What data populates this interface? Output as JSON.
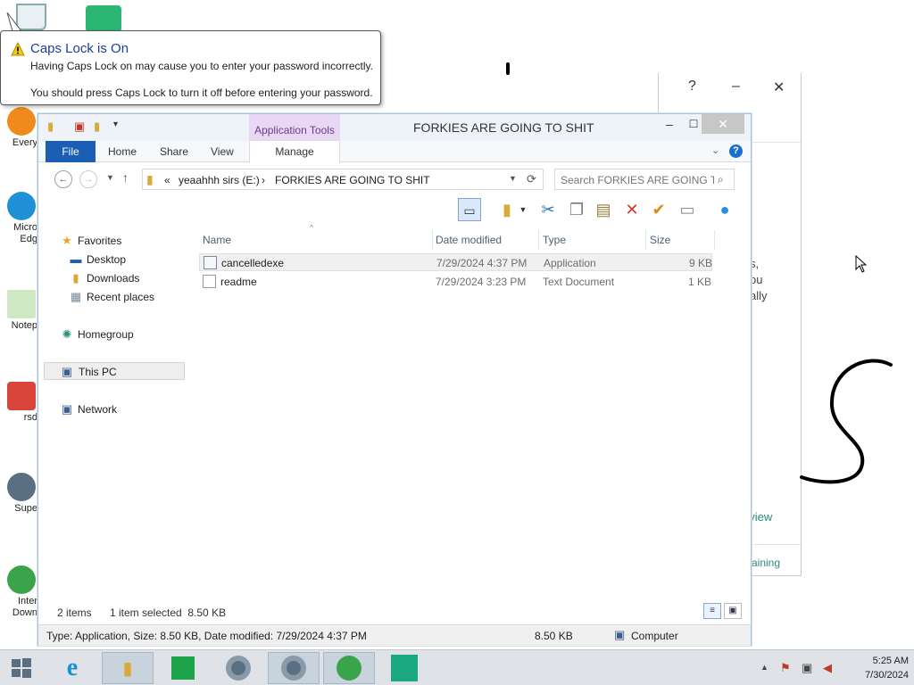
{
  "caps_lock_balloon": {
    "title": "Caps Lock is On",
    "line1": "Having Caps Lock on may cause you to enter your password incorrectly.",
    "line2": "You should press Caps Lock to turn it off before entering your password."
  },
  "desktop_icons": [
    {
      "label": "Every",
      "icon": "everything-icon"
    },
    {
      "label": "Micro Edg",
      "icon": "edge-icon"
    },
    {
      "label": "Notep",
      "icon": "notepad-icon"
    },
    {
      "label": "rsd",
      "icon": "app-icon"
    },
    {
      "label": "Supe",
      "icon": "super-icon"
    },
    {
      "label": "Inter Down",
      "icon": "internet-download-manager-icon"
    }
  ],
  "background_window": {
    "help": "?",
    "minimize": "–",
    "close": "✕",
    "fragments": [
      "s,",
      "ou",
      "ally"
    ],
    "link1": "eview",
    "link2": "maining"
  },
  "explorer": {
    "title": "FORKIES ARE GOING TO SHIT",
    "contextual_tab_header": "Application Tools",
    "tabs": [
      "File",
      "Home",
      "Share",
      "View",
      "Manage"
    ],
    "address": {
      "chevron": "«",
      "drive": "yeaahhh sirs (E:)",
      "separator": "›",
      "folder": "FORKIES ARE GOING TO SHIT"
    },
    "search_placeholder": "Search FORKIES ARE GOING T...",
    "nav_pane": {
      "favorites": "Favorites",
      "desktop": "Desktop",
      "downloads": "Downloads",
      "recent": "Recent places",
      "homegroup": "Homegroup",
      "this_pc": "This PC",
      "network": "Network"
    },
    "columns": [
      "Name",
      "Date modified",
      "Type",
      "Size"
    ],
    "files": [
      {
        "name": "cancelledexe",
        "date": "7/29/2024 4:37 PM",
        "type": "Application",
        "size": "9 KB",
        "selected": true
      },
      {
        "name": "readme",
        "date": "7/29/2024 3:23 PM",
        "type": "Text Document",
        "size": "1 KB",
        "selected": false
      }
    ],
    "status": {
      "items": "2 items",
      "selected": "1 item selected  8.50 KB"
    },
    "details": {
      "summary": "Type: Application, Size: 8.50 KB, Date modified: 7/29/2024 4:37 PM",
      "size": "8.50 KB",
      "location": "Computer"
    }
  },
  "taskbar": {
    "apps": [
      "start-icon",
      "internet-explorer-icon",
      "file-explorer-icon",
      "store-icon",
      "chrome-icon",
      "chrome-icon",
      "internet-download-manager-icon",
      "app-icon"
    ],
    "clock_time": "5:25 AM",
    "clock_date": "7/30/2024"
  },
  "colors": {
    "file_tab": "#1a5fb4",
    "app_tools_tab": "#e8d8f3",
    "title_text": "#1c3f94"
  }
}
